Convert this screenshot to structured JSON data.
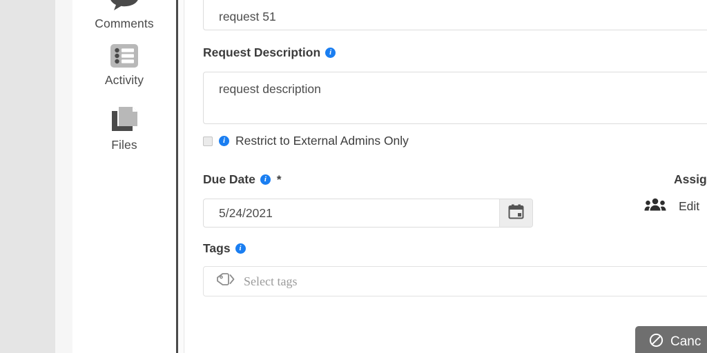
{
  "sidebar": {
    "items": [
      {
        "label": "Comments",
        "icon": "comments-icon"
      },
      {
        "label": "Activity",
        "icon": "activity-list-icon"
      },
      {
        "label": "Files",
        "icon": "files-copy-icon"
      }
    ]
  },
  "form": {
    "request_title": {
      "value": "request 51"
    },
    "request_description": {
      "label": "Request Description",
      "info_icon": "info-icon",
      "value": "request description"
    },
    "restrict_external": {
      "label": "Restrict to External Admins Only",
      "checked": false,
      "info_icon": "info-icon"
    },
    "due_date": {
      "label": "Due Date",
      "required_marker": "*",
      "info_icon": "info-icon",
      "value": "5/24/2021",
      "calendar_icon": "calendar-icon"
    },
    "tags": {
      "label": "Tags",
      "info_icon": "info-icon",
      "placeholder": "Select tags",
      "tag_icon": "tags-icon"
    }
  },
  "assignees": {
    "label": "Assig",
    "edit_label": "Edit",
    "group_icon": "users-group-icon"
  },
  "footer": {
    "cancel_label": "Canc",
    "cancel_icon": "no-entry-icon"
  },
  "colors": {
    "info_blue": "#1a7ef1",
    "cancel_gray": "#6f6f6f",
    "gutter_gray": "#e5e5e5",
    "divider_dark": "#4a4a4a"
  }
}
